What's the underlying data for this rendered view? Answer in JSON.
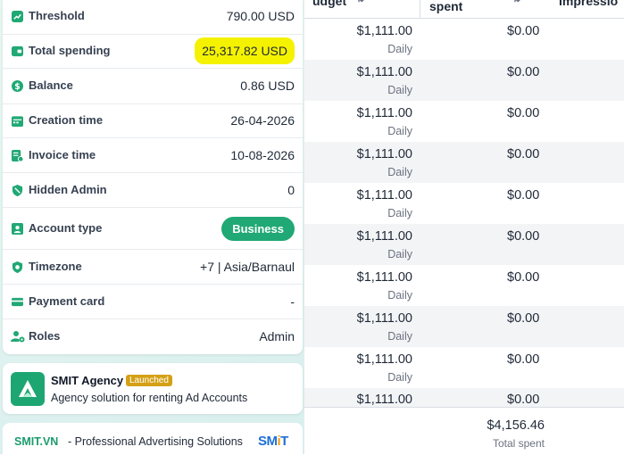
{
  "table": {
    "headers": {
      "budget": "udget",
      "budget_sort_icon": "sort-arrows-icon",
      "spent": "spent",
      "spent_sort_icon": "sort-arrows-icon",
      "impressions": "Impressio"
    },
    "rows": [
      {
        "budget": "$1,111.00",
        "period": "Daily",
        "spent": "$0.00"
      },
      {
        "budget": "$1,111.00",
        "period": "Daily",
        "spent": "$0.00"
      },
      {
        "budget": "$1,111.00",
        "period": "Daily",
        "spent": "$0.00"
      },
      {
        "budget": "$1,111.00",
        "period": "Daily",
        "spent": "$0.00"
      },
      {
        "budget": "$1,111.00",
        "period": "Daily",
        "spent": "$0.00"
      },
      {
        "budget": "$1,111.00",
        "period": "Daily",
        "spent": "$0.00"
      },
      {
        "budget": "$1,111.00",
        "period": "Daily",
        "spent": "$0.00"
      },
      {
        "budget": "$1,111.00",
        "period": "Daily",
        "spent": "$0.00"
      },
      {
        "budget": "$1,111.00",
        "period": "Daily",
        "spent": "$0.00"
      },
      {
        "budget": "$1,111.00",
        "period": "",
        "spent": "$0.00"
      }
    ],
    "footer": {
      "total_value": "$4,156.46",
      "total_label": "Total spent"
    }
  },
  "account_info": {
    "threshold": {
      "label": "Threshold",
      "value": "790.00 USD",
      "icon": "trend-up-icon"
    },
    "total_spending": {
      "label": "Total spending",
      "value": "25,317.82 USD",
      "icon": "wallet-icon"
    },
    "balance": {
      "label": "Balance",
      "value": "0.86 USD",
      "icon": "dollar-circle-icon"
    },
    "creation_time": {
      "label": "Creation time",
      "value": "26-04-2026",
      "icon": "calendar-icon"
    },
    "invoice_time": {
      "label": "Invoice time",
      "value": "10-08-2026",
      "icon": "invoice-icon"
    },
    "hidden_admin": {
      "label": "Hidden Admin",
      "value": "0",
      "icon": "shield-hidden-icon"
    },
    "account_type": {
      "label": "Account type",
      "value": "Business",
      "icon": "id-card-icon"
    },
    "timezone": {
      "label": "Timezone",
      "value": "+7 | Asia/Barnaul",
      "icon": "shield-clock-icon"
    },
    "payment_card": {
      "label": "Payment card",
      "value": "-",
      "icon": "credit-card-icon"
    },
    "roles": {
      "label": "Roles",
      "value": "Admin",
      "icon": "user-gear-icon"
    }
  },
  "agency": {
    "title": "SMIT Agency",
    "badge": "Launched",
    "description": "Agency solution for renting Ad Accounts",
    "logo_icon": "smit-agency-logo"
  },
  "promo": {
    "brand": "SMIT.VN",
    "text": " - Professional Advertising Solutions",
    "logo_parts": [
      "SM",
      "i",
      "T"
    ]
  },
  "colors": {
    "accent_green": "#20a875",
    "highlight_yellow": "#f5f200",
    "badge_gold": "#d4a015",
    "logo_blue": "#1d6fd8",
    "logo_orange": "#f59e0b"
  }
}
